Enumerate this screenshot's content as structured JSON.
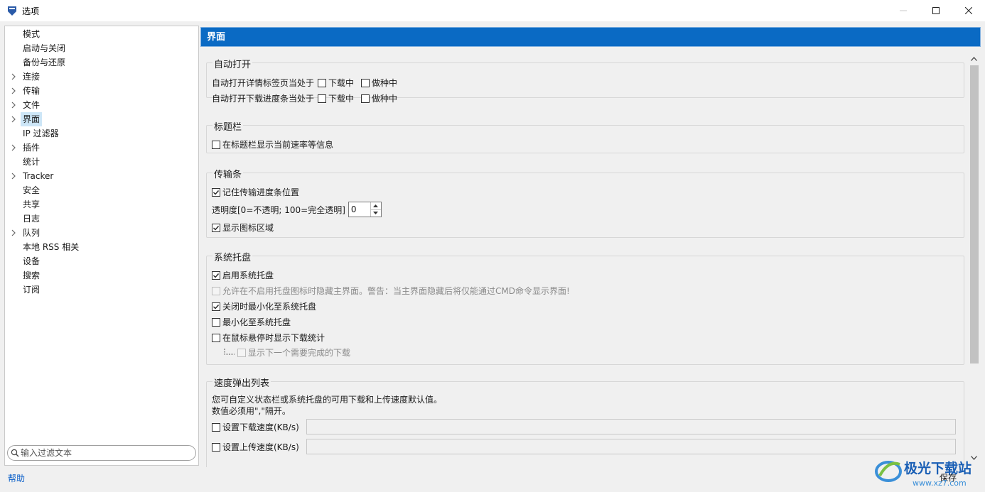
{
  "window": {
    "title": "选项",
    "icon": "app-logo-icon"
  },
  "sidebar": {
    "items": [
      {
        "label": "模式",
        "expandable": false,
        "selected": false
      },
      {
        "label": "启动与关闭",
        "expandable": false,
        "selected": false
      },
      {
        "label": "备份与还原",
        "expandable": false,
        "selected": false
      },
      {
        "label": "连接",
        "expandable": true,
        "selected": false
      },
      {
        "label": "传输",
        "expandable": true,
        "selected": false
      },
      {
        "label": "文件",
        "expandable": true,
        "selected": false
      },
      {
        "label": "界面",
        "expandable": true,
        "selected": true
      },
      {
        "label": "IP 过滤器",
        "expandable": false,
        "selected": false
      },
      {
        "label": "插件",
        "expandable": true,
        "selected": false
      },
      {
        "label": "统计",
        "expandable": false,
        "selected": false
      },
      {
        "label": "Tracker",
        "expandable": true,
        "selected": false
      },
      {
        "label": "安全",
        "expandable": false,
        "selected": false
      },
      {
        "label": "共享",
        "expandable": false,
        "selected": false
      },
      {
        "label": "日志",
        "expandable": false,
        "selected": false
      },
      {
        "label": "队列",
        "expandable": true,
        "selected": false
      },
      {
        "label": "本地 RSS 相关",
        "expandable": false,
        "selected": false
      },
      {
        "label": "设备",
        "expandable": false,
        "selected": false
      },
      {
        "label": "搜索",
        "expandable": false,
        "selected": false
      },
      {
        "label": "订阅",
        "expandable": false,
        "selected": false
      }
    ],
    "filter_placeholder": "输入过滤文本"
  },
  "footer": {
    "help_label": "帮助",
    "save_label": "保存"
  },
  "page": {
    "title": "界面",
    "auto_open": {
      "title": "自动打开",
      "row1_label": "自动打开详情标签页当处于",
      "row2_label": "自动打开下载进度条当处于",
      "downloading_label": "下载中",
      "seeding_label": "做种中",
      "row1_downloading": false,
      "row1_seeding": false,
      "row2_downloading": false,
      "row2_seeding": false
    },
    "titlebar": {
      "title": "标题栏",
      "show_speed_label": "在标题栏显示当前速率等信息",
      "show_speed": false
    },
    "transfer_bar": {
      "title": "传输条",
      "remember_pos_label": "记住传输进度条位置",
      "remember_pos": true,
      "opacity_label": "透明度[0=不透明; 100=完全透明]",
      "opacity_value": "0",
      "show_icon_area_label": "显示图标区域",
      "show_icon_area": true
    },
    "tray": {
      "title": "系统托盘",
      "enable_label": "启用系统托盘",
      "enable": true,
      "hide_without_tray_label": "允许在不启用托盘图标时隐藏主界面。警告：当主界面隐藏后将仅能通过CMD命令显示界面!",
      "hide_without_tray": false,
      "close_to_tray_label": "关闭时最小化至系统托盘",
      "close_to_tray": true,
      "minimize_to_tray_label": "最小化至系统托盘",
      "minimize_to_tray": false,
      "hover_stats_label": "在鼠标悬停时显示下载统计",
      "hover_stats": false,
      "show_next_label": "显示下一个需要完成的下载",
      "show_next": false
    },
    "speed_popup": {
      "title": "速度弹出列表",
      "description_line1": "您可自定义状态栏或系统托盘的可用下载和上传速度默认值。",
      "description_line2": "数值必须用\",\"隔开。",
      "download_label": "设置下载速度(KB/s)",
      "download_enabled": false,
      "upload_label": "设置上传速度(KB/s)",
      "upload_enabled": false,
      "download_value": "",
      "upload_value": ""
    }
  },
  "colors": {
    "header_bg": "#0a6ac4",
    "selected_bg": "#cde6f7",
    "link": "#0a5fc9"
  },
  "watermark": {
    "text": "极光下载站",
    "url": "www.xz7.com"
  }
}
